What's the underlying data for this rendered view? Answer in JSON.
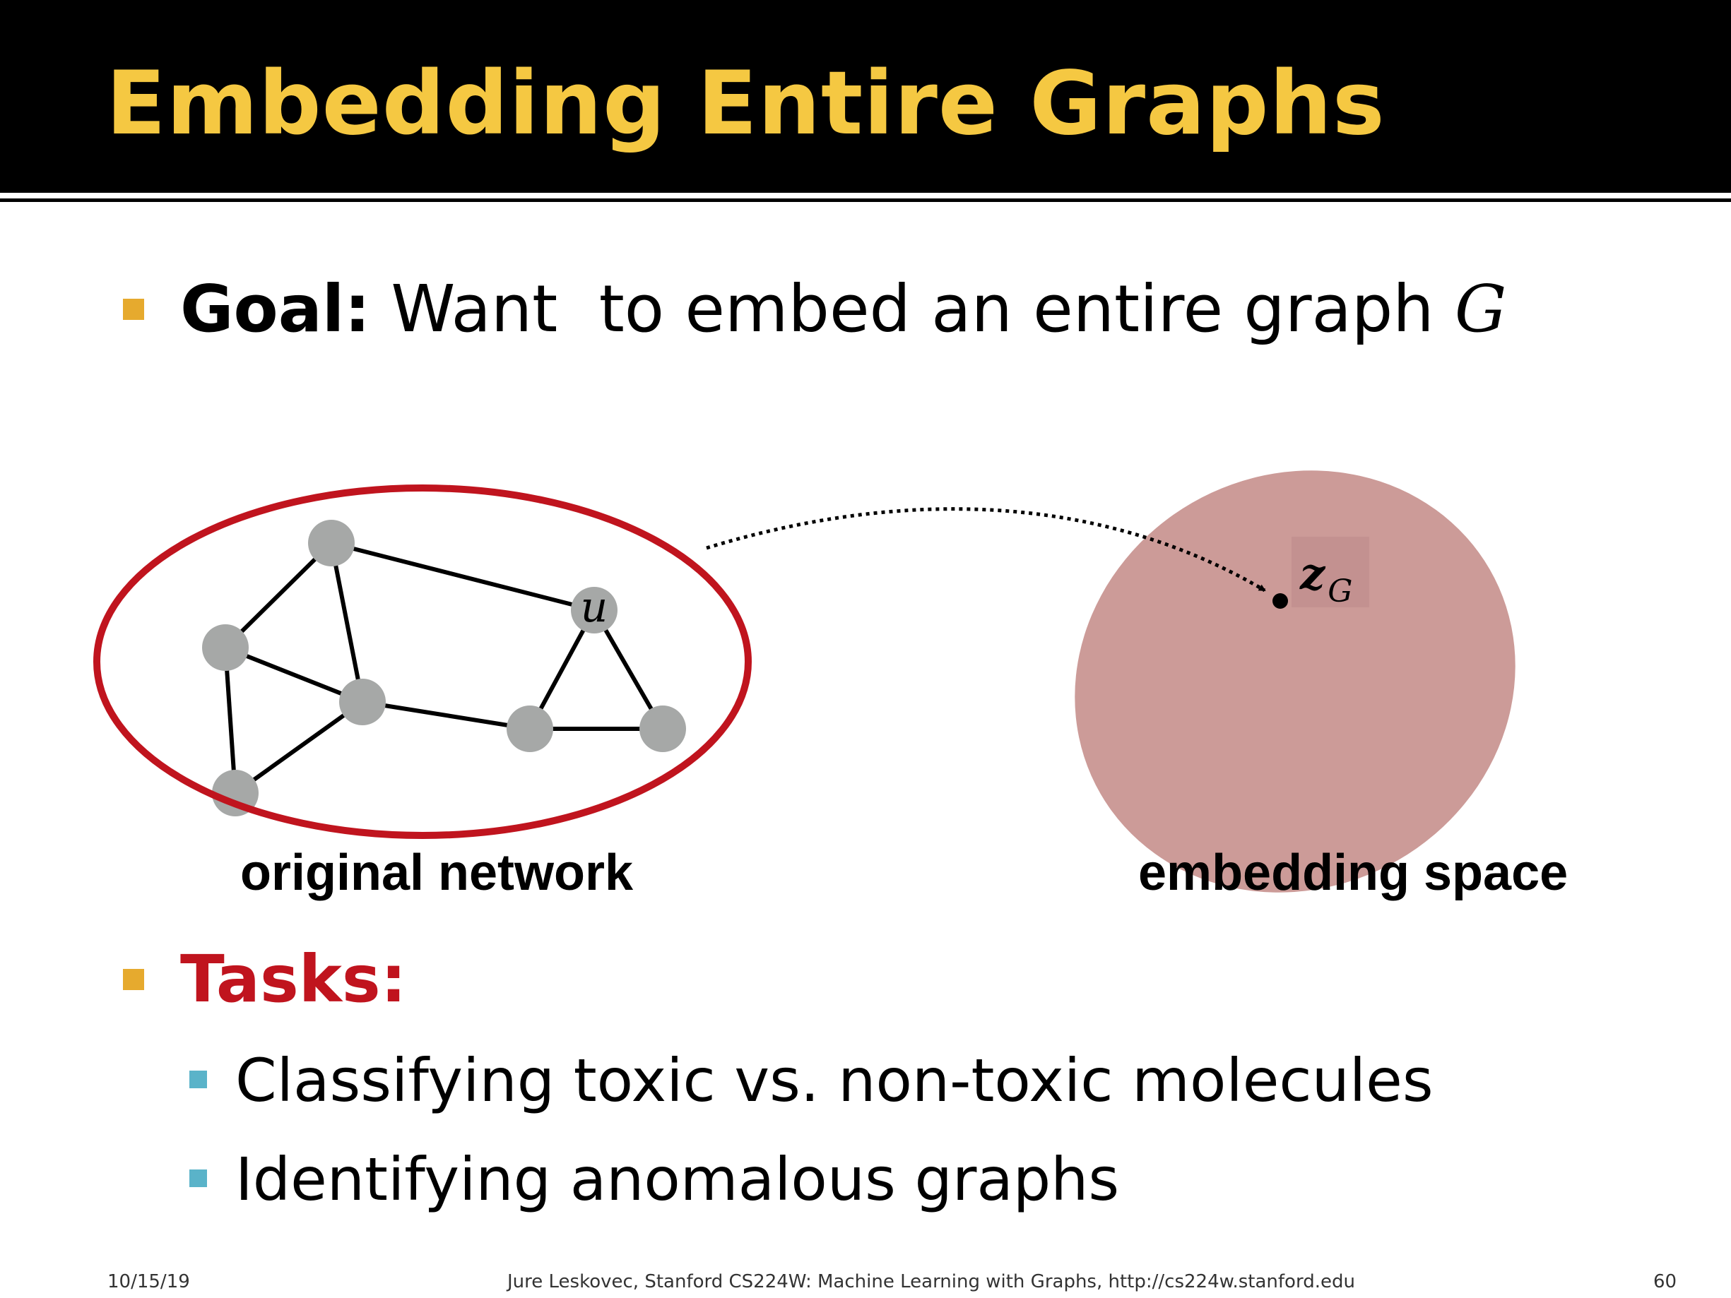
{
  "title": "Embedding Entire Graphs",
  "goal": {
    "label": "Goal:",
    "text": "Want  to embed an entire graph ",
    "symbol": "G"
  },
  "diagram": {
    "node_label": "u",
    "embedding_symbol": "z",
    "embedding_subscript": "G",
    "original_label": "original network",
    "embedding_label": "embedding space",
    "colors": {
      "node": "#a6a8a7",
      "edge": "#000000",
      "ellipse": "#c0141e",
      "embedding_space": "#cc9b98"
    }
  },
  "tasks": {
    "label": "Tasks:",
    "label_color": "#c0141e",
    "items": [
      "Classifying toxic vs. non-toxic molecules",
      "Identifying anomalous graphs"
    ]
  },
  "footer": {
    "date": "10/15/19",
    "credit": "Jure Leskovec, Stanford CS224W: Machine Learning with Graphs, http://cs224w.stanford.edu",
    "page": "60"
  },
  "colors": {
    "title": "#f5c842",
    "title_bar": "#000000",
    "bullet": "#e6aa2e",
    "sub_bullet": "#5ab3c9"
  }
}
